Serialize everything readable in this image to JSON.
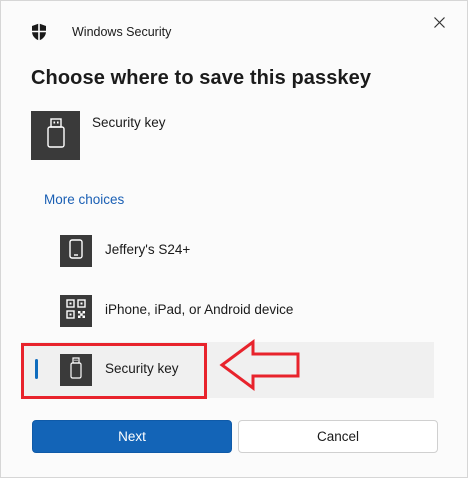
{
  "window": {
    "title": "Windows Security",
    "close_icon": "close-icon"
  },
  "dialog": {
    "heading": "Choose where to save this passkey",
    "selected": {
      "label": "Security key",
      "icon": "usb-key-icon"
    },
    "more_choices_label": "More choices",
    "options": [
      {
        "label": "Jeffery's S24+",
        "icon": "phone-icon"
      },
      {
        "label": "iPhone, iPad, or Android device",
        "icon": "qr-code-icon"
      },
      {
        "label": "Security key",
        "icon": "usb-key-icon",
        "selected": true
      }
    ]
  },
  "buttons": {
    "next_label": "Next",
    "cancel_label": "Cancel"
  },
  "annotation": {
    "highlight_color": "#e8232c",
    "arrow_icon": "left-arrow-outline-icon"
  },
  "colors": {
    "accent": "#1364b7",
    "link": "#1a5fb4",
    "tile": "#3a3a3a"
  }
}
